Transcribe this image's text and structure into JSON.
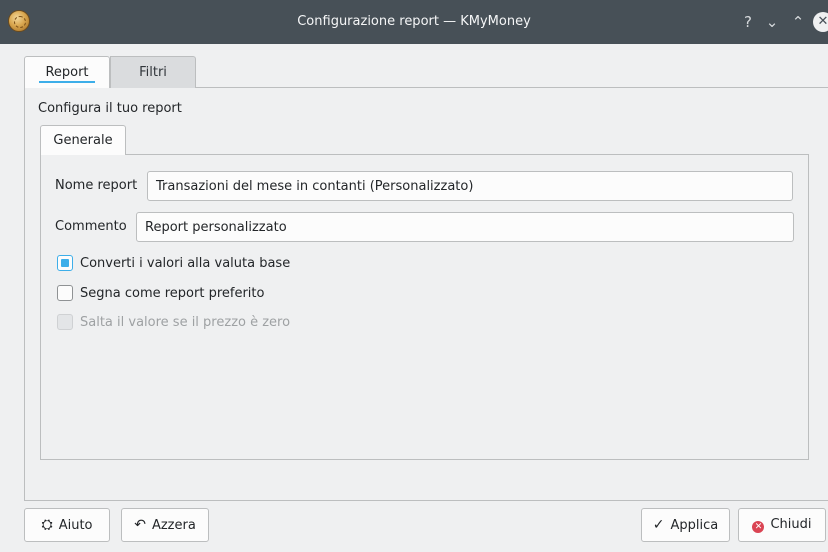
{
  "window": {
    "title": "Configurazione report — KMyMoney",
    "controls": {
      "help": "?",
      "minimize": "⌄",
      "maximize": "⌃",
      "close": "✕"
    }
  },
  "tabs": [
    {
      "label": "Report",
      "selected": true
    },
    {
      "label": "Filtri",
      "selected": false
    }
  ],
  "report_panel": {
    "heading": "Configura il tuo report",
    "inner_tab": "Generale",
    "nome_report": {
      "label": "Nome report",
      "value": "Transazioni del mese in contanti (Personalizzato)"
    },
    "commento": {
      "label": "Commento",
      "value": "Report personalizzato"
    },
    "checkboxes": [
      {
        "label": "Converti i valori alla valuta base",
        "checked": true,
        "enabled": true
      },
      {
        "label": "Segna come report preferito",
        "checked": false,
        "enabled": true
      },
      {
        "label": "Salta il valore se il prezzo è zero",
        "checked": false,
        "enabled": false
      }
    ]
  },
  "buttons": {
    "aiuto": {
      "label": "Aiuto",
      "icon": "help-lifebuoy-icon",
      "glyph": "⛭"
    },
    "azzera": {
      "label": "Azzera",
      "icon": "reset-icon",
      "glyph": "↶"
    },
    "applica": {
      "label": "Applica",
      "icon": "check-icon",
      "glyph": "✓"
    },
    "chiudi": {
      "label": "Chiudi",
      "icon": "close-icon",
      "glyph": "✕"
    }
  },
  "colors": {
    "accent": "#3daee9",
    "titlebar": "#475057",
    "background": "#eff0f1",
    "close": "#da4453"
  }
}
